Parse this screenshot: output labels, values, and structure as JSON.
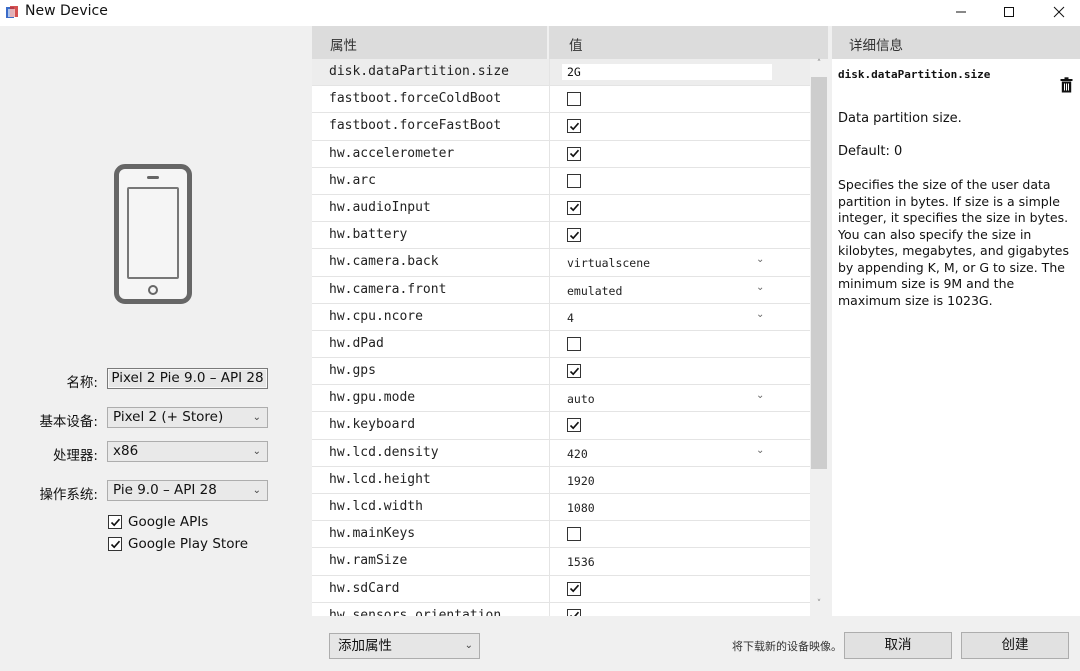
{
  "window": {
    "title": "New Device"
  },
  "form": {
    "name_label": "名称:",
    "name_value": "Pixel 2 Pie 9.0 – API 28",
    "base_label": "基本设备:",
    "base_value": "Pixel 2 (+ Store)",
    "cpu_label": "处理器:",
    "cpu_value": "x86",
    "os_label": "操作系统:",
    "os_value": "Pie 9.0 – API 28",
    "google_apis_label": "Google APIs",
    "google_apis_checked": true,
    "google_play_label": "Google Play Store",
    "google_play_checked": true
  },
  "table": {
    "col_property": "属性",
    "col_value": "值",
    "rows": [
      {
        "key": "disk.dataPartition.size",
        "type": "input",
        "value": "2G",
        "selected": true
      },
      {
        "key": "fastboot.forceColdBoot",
        "type": "check",
        "checked": false
      },
      {
        "key": "fastboot.forceFastBoot",
        "type": "check",
        "checked": true
      },
      {
        "key": "hw.accelerometer",
        "type": "check",
        "checked": true
      },
      {
        "key": "hw.arc",
        "type": "check",
        "checked": false
      },
      {
        "key": "hw.audioInput",
        "type": "check",
        "checked": true
      },
      {
        "key": "hw.battery",
        "type": "check",
        "checked": true
      },
      {
        "key": "hw.camera.back",
        "type": "select",
        "value": "virtualscene"
      },
      {
        "key": "hw.camera.front",
        "type": "select",
        "value": "emulated"
      },
      {
        "key": "hw.cpu.ncore",
        "type": "select",
        "value": "4"
      },
      {
        "key": "hw.dPad",
        "type": "check",
        "checked": false
      },
      {
        "key": "hw.gps",
        "type": "check",
        "checked": true
      },
      {
        "key": "hw.gpu.mode",
        "type": "select",
        "value": "auto"
      },
      {
        "key": "hw.keyboard",
        "type": "check",
        "checked": true
      },
      {
        "key": "hw.lcd.density",
        "type": "select",
        "value": "420"
      },
      {
        "key": "hw.lcd.height",
        "type": "text",
        "value": "1920"
      },
      {
        "key": "hw.lcd.width",
        "type": "text",
        "value": "1080"
      },
      {
        "key": "hw.mainKeys",
        "type": "check",
        "checked": false
      },
      {
        "key": "hw.ramSize",
        "type": "text",
        "value": "1536"
      },
      {
        "key": "hw.sdCard",
        "type": "check",
        "checked": true
      },
      {
        "key": "hw.sensors.orientation",
        "type": "check",
        "checked": true
      }
    ]
  },
  "details": {
    "header": "详细信息",
    "key": "disk.dataPartition.size",
    "summary": "Data partition size.",
    "default": "Default: 0",
    "description": "Specifies the size of the user data partition in bytes. If size is a simple integer, it specifies the size in bytes. You can also specify the size in kilobytes, megabytes, and gigabytes by appending K, M, or G to size. The minimum size is 9M and the maximum size is 1023G."
  },
  "footer": {
    "add_property": "添加属性",
    "status": "将下载新的设备映像。",
    "cancel": "取消",
    "create": "创建"
  },
  "icons": {
    "app": "app-icon",
    "trash": "trash-icon",
    "check": "checkmark-icon",
    "dropdown": "chevron-down-icon"
  }
}
